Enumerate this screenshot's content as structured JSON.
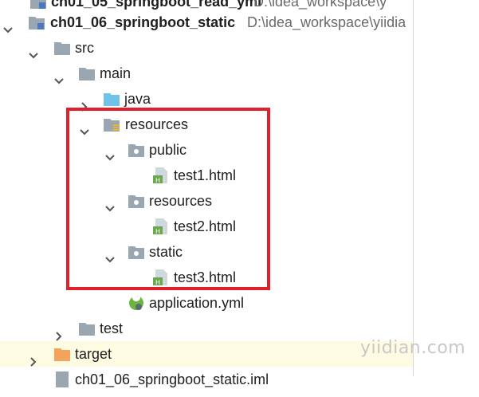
{
  "tree": {
    "row_top_partial": {
      "label": "ch01_05_springboot_read_yml",
      "path": "D:\\idea_workspace\\y"
    },
    "row_project": {
      "label": "ch01_06_springboot_static",
      "path": "D:\\idea_workspace\\yiidia"
    },
    "row_src": {
      "label": "src"
    },
    "row_main": {
      "label": "main"
    },
    "row_java": {
      "label": "java"
    },
    "row_resources": {
      "label": "resources"
    },
    "row_public": {
      "label": "public"
    },
    "row_test1": {
      "label": "test1.html"
    },
    "row_resources_sub": {
      "label": "resources"
    },
    "row_test2": {
      "label": "test2.html"
    },
    "row_static": {
      "label": "static"
    },
    "row_test3": {
      "label": "test3.html"
    },
    "row_appyml": {
      "label": "application.yml"
    },
    "row_test": {
      "label": "test"
    },
    "row_target": {
      "label": "target"
    },
    "row_bottom_partial": {
      "label": "ch01_06_springboot_static.iml"
    }
  },
  "watermark": {
    "text": "yiidian.com"
  },
  "colors": {
    "highlight_box": "#e0212b",
    "folder_gray": "#9aa7b0",
    "folder_blue": "#6fc3ea",
    "folder_orange": "#f4a35c",
    "html_green": "#6aa84f",
    "spring_green": "#6db33f"
  }
}
